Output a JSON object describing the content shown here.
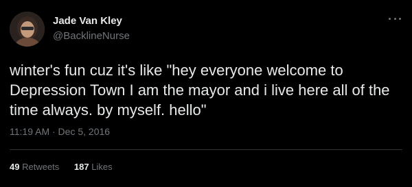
{
  "author": {
    "name": "Jade Van Kley",
    "handle": "@BacklineNurse"
  },
  "tweet": {
    "text": "winter's fun cuz it's like \"hey everyone welcome to Depression Town I am the mayor and i live here all of the time always. by myself. hello\"",
    "timestamp": "11:19 AM · Dec 5, 2016"
  },
  "stats": {
    "retweets_count": "49",
    "retweets_label": "Retweets",
    "likes_count": "187",
    "likes_label": "Likes"
  },
  "icons": {
    "more": "more-horizontal-icon"
  },
  "colors": {
    "background": "#000000",
    "primary_text": "#e7e9ea",
    "secondary_text": "#71767b"
  }
}
